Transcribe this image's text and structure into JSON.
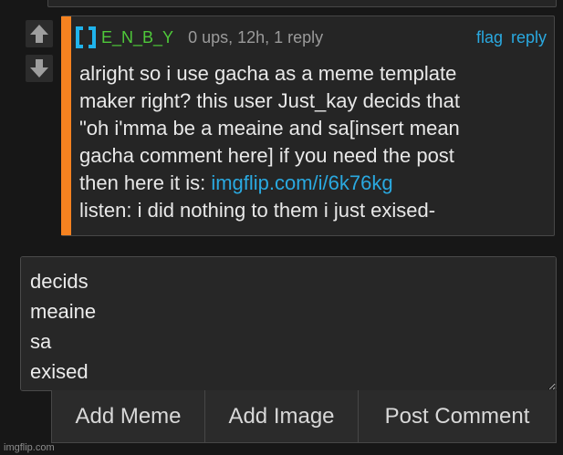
{
  "comment": {
    "username": "E_N_B_Y",
    "meta": "0 ups, 12h, 1 reply",
    "actions": {
      "flag": "flag",
      "reply": "reply"
    },
    "text": {
      "line1": "alright so i use gacha as a meme template",
      "line2": "maker right? this user Just_kay decids that",
      "line3": "\"oh i'mma be a meaine and sa[insert mean",
      "line4": "gacha comment here] if you need the post",
      "line5_prefix": "then here it is: ",
      "line5_link": "imgflip.com/i/6k76kg",
      "line6": "listen: i did nothing to them i just exised-"
    },
    "accent_color": "#f58220",
    "username_color": "#4fc93a",
    "link_color": "#2aa9e0"
  },
  "reply_box": {
    "value": "decids\nmeaine\nsa\nexised"
  },
  "buttons": {
    "add_meme": "Add Meme",
    "add_image": "Add Image",
    "post_comment": "Post Comment"
  },
  "watermark": "imgflip.com",
  "icons": {
    "upvote": "arrow-up-icon",
    "downvote": "arrow-down-icon",
    "avatar": "bracket-avatar-icon"
  }
}
